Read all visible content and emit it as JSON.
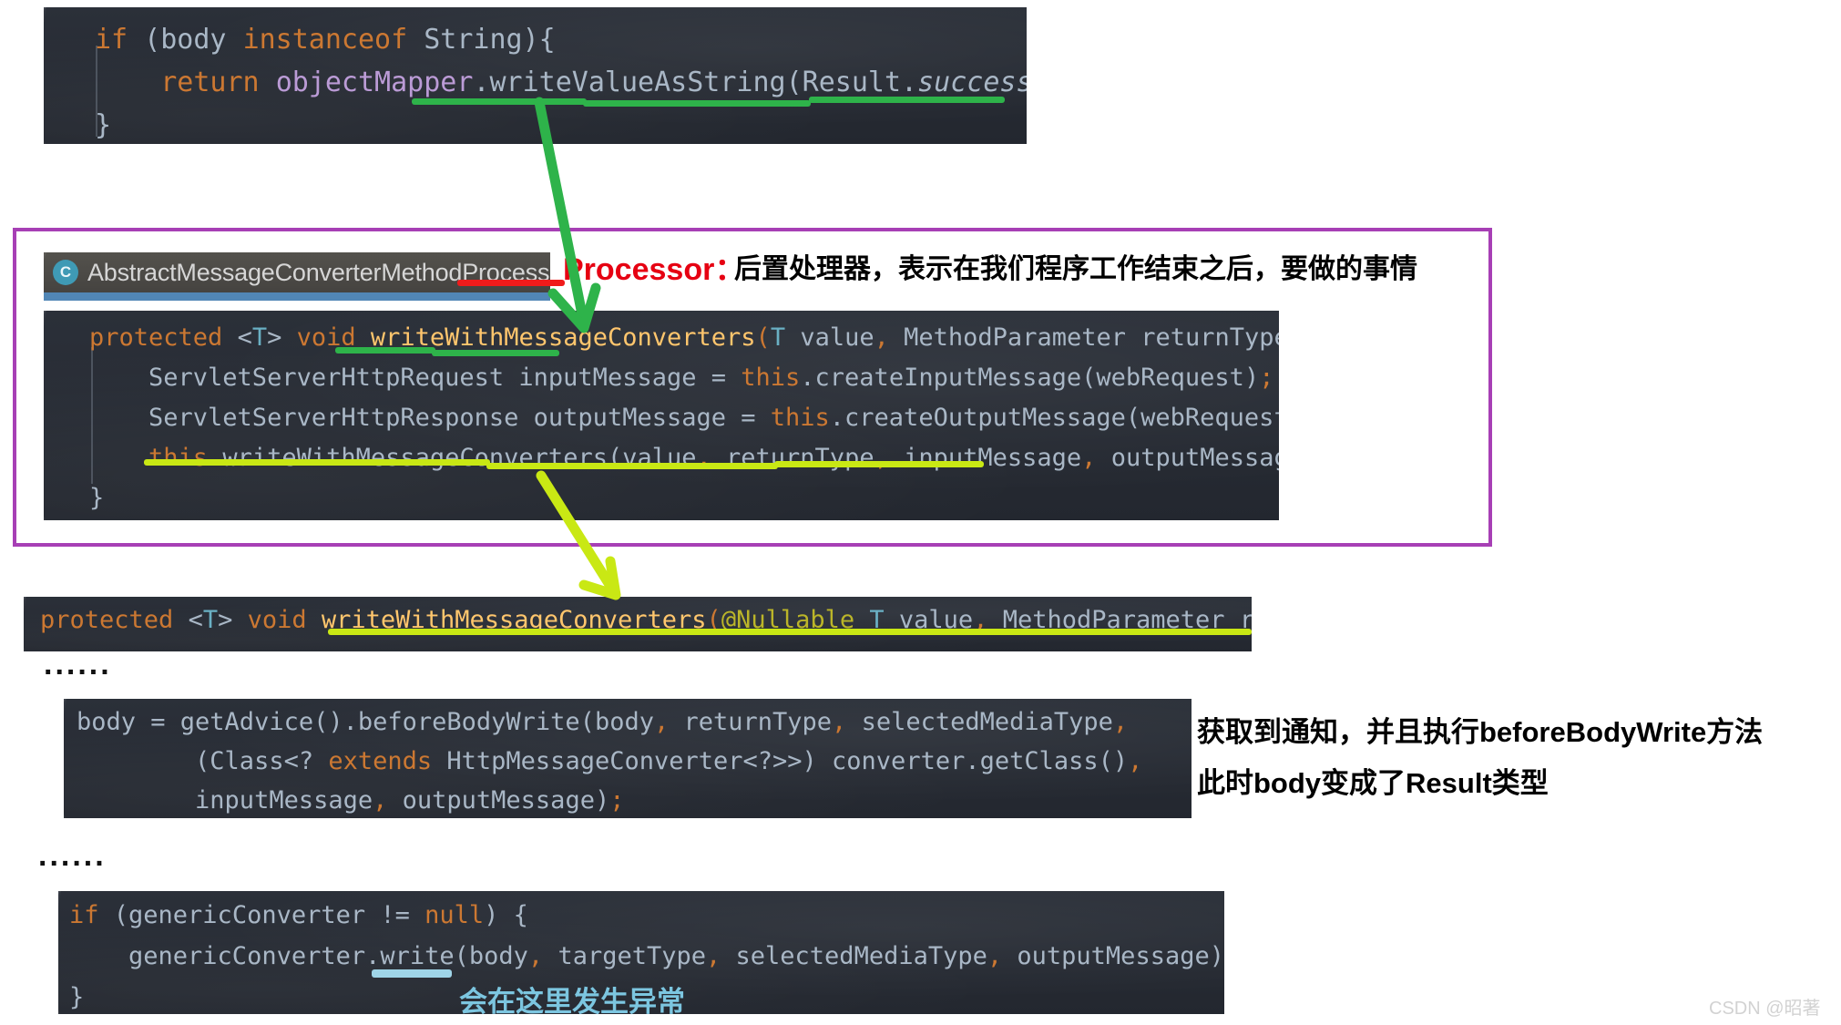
{
  "colors": {
    "green_marker": "#2eb34a",
    "lime_marker": "#c9e814",
    "red_marker": "#f01b1b",
    "blue_marker": "#9fd5e8",
    "purple_box": "#a73fb5",
    "code_bg": "#252a32",
    "tab_bg": "#4b4945",
    "tab_active_underline": "#5186b5",
    "annotation_red": "#e60012",
    "annotation_blue": "#7cc6e0"
  },
  "code_block_1": {
    "name": "objectMapper-string-branch",
    "lines": [
      "if (body instanceof String){",
      "    return objectMapper.writeValueAsString(Result.success(body));",
      "}"
    ]
  },
  "ide_tab": {
    "icon": "class-file-icon",
    "icon_letter": "C",
    "label": "AbstractMessageConverterMethodProcessor.c"
  },
  "processor_note": {
    "prefix": "Processor：",
    "text": "后置处理器，表示在我们程序工作结束之后，要做的事情"
  },
  "code_block_2": {
    "name": "writeWithMessageConverters-webrequest-overload",
    "lines": [
      "protected <T> void writeWithMessageConverters(T value, MethodParameter returnType, Na",
      "    ServletServerHttpRequest inputMessage = this.createInputMessage(webRequest);",
      "    ServletServerHttpResponse outputMessage = this.createOutputMessage(webRequest);",
      "    this.writeWithMessageConverters(value, returnType, inputMessage, outputMessage);",
      "}"
    ]
  },
  "code_block_3": {
    "name": "writeWithMessageConverters-nullable-overload",
    "lines": [
      "protected <T> void writeWithMessageConverters(@Nullable T value, MethodParameter re"
    ]
  },
  "ellipsis_1": "......",
  "code_block_4": {
    "name": "before-body-write-call",
    "lines": [
      "body = getAdvice().beforeBodyWrite(body, returnType, selectedMediaType,",
      "        (Class<? extends HttpMessageConverter<?>>) converter.getClass(),",
      "        inputMessage, outputMessage);"
    ]
  },
  "advice_note": {
    "line1": "获取到通知，并且执行beforeBodyWrite方法",
    "line2": "此时body变成了Result类型"
  },
  "ellipsis_2": "......",
  "code_block_5": {
    "name": "generic-converter-write",
    "lines": [
      "if (genericConverter != null) {",
      "    genericConverter.write(body, targetType, selectedMediaType, outputMessage);",
      "}"
    ]
  },
  "exception_note": "会在这里发生异常",
  "watermark": "CSDN @昭著"
}
